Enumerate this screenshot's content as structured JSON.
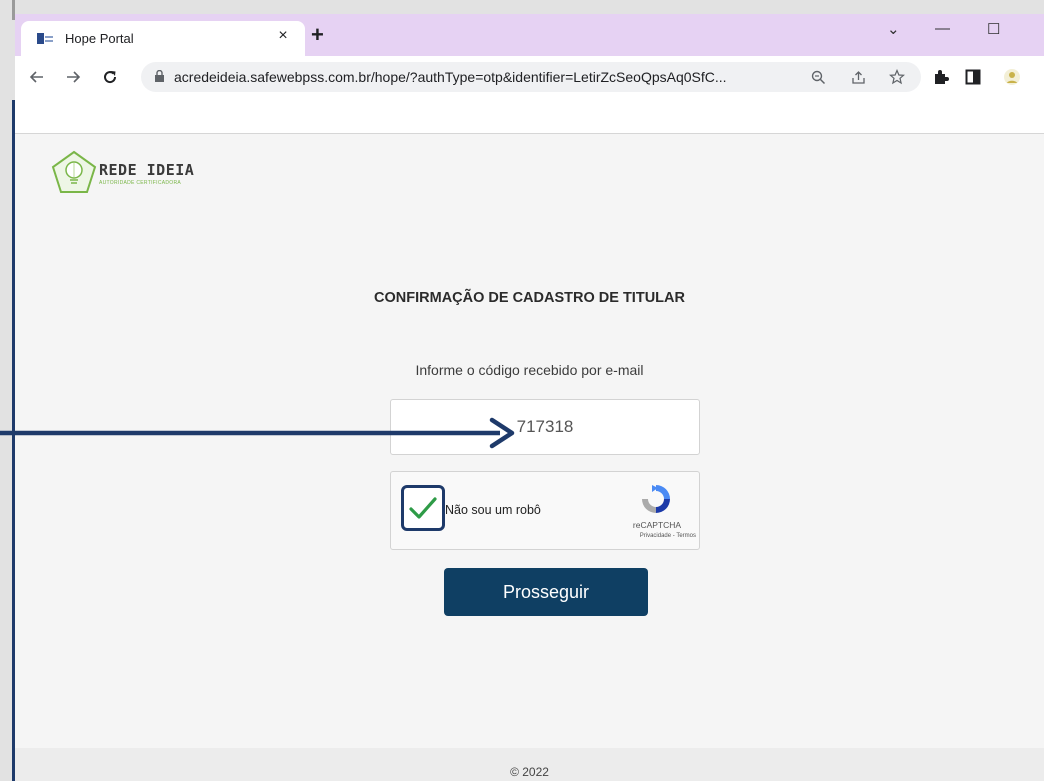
{
  "browser": {
    "tab_title": "Hope Portal",
    "tab_close": "×",
    "new_tab": "+",
    "url": "acredeideia.safewebpss.com.br/hope/?authType=otp&identifier=LetirZcSeoQpsAq0SfC...",
    "window_controls": {
      "minimize": "—",
      "maximize": "☐",
      "chevron": "⌄"
    },
    "icons": [
      "back-icon",
      "forward-icon",
      "reload-icon",
      "lock-icon",
      "zoom-icon",
      "share-icon",
      "star-icon",
      "extensions-icon",
      "sidepanel-icon",
      "profile-icon"
    ]
  },
  "logo": {
    "name": "REDE IDEIA",
    "tagline": "AUTORIDADE CERTIFICADORA"
  },
  "form": {
    "heading": "CONFIRMAÇÃO DE CADASTRO DE TITULAR",
    "hint": "Informe o código recebido por e-mail",
    "code_value": "717318",
    "captcha": {
      "checked": true,
      "label": "Não sou um robô",
      "brand": "reCAPTCHA",
      "links": "Privacidade - Termos"
    },
    "submit_label": "Prosseguir"
  },
  "footer": {
    "text": "© 2022"
  },
  "colors": {
    "tabstrip": "#e6d2f3",
    "primary_button": "#0f3f63",
    "annotation": "#1e3a6a",
    "checkmark": "#2e9b47"
  }
}
